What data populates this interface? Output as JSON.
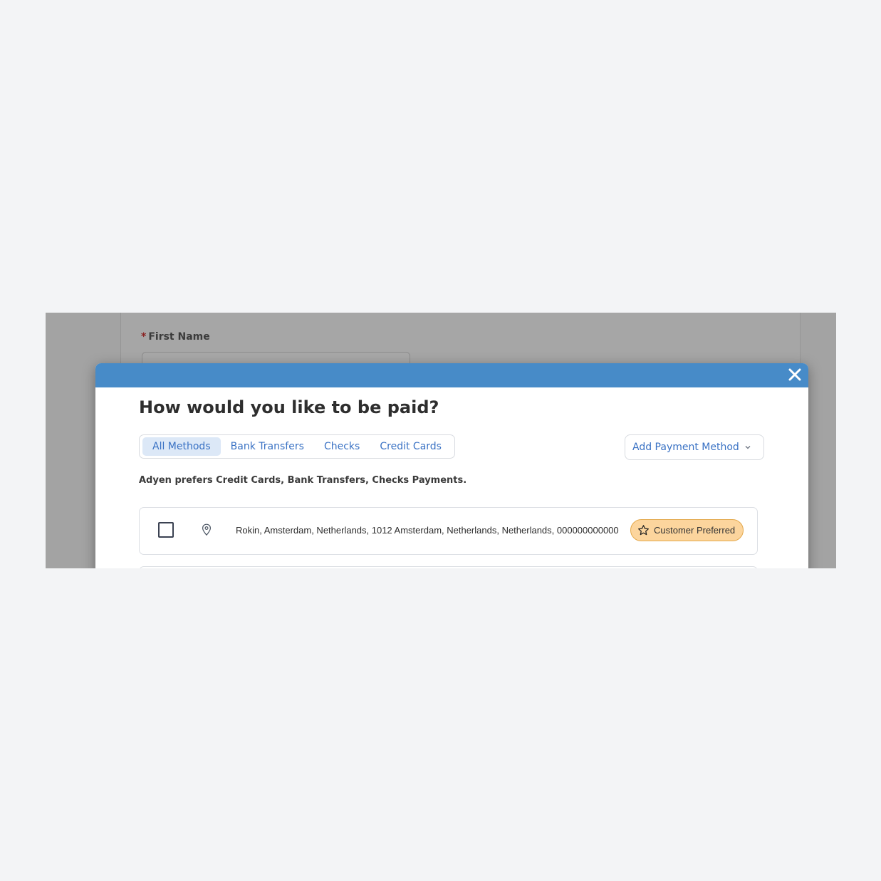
{
  "background_form": {
    "first_name_label": "First Name",
    "required_marker": "*"
  },
  "modal": {
    "title": "How would you like to be paid?",
    "header_color": "#478bc8",
    "close_icon": "close-icon",
    "tabs": [
      {
        "label": "All Methods",
        "active": true
      },
      {
        "label": "Bank Transfers",
        "active": false
      },
      {
        "label": "Checks",
        "active": false
      },
      {
        "label": "Credit Cards",
        "active": false
      }
    ],
    "add_button_label": "Add Payment Method",
    "preference_text": "Adyen prefers Credit Cards, Bank Transfers, Checks Payments.",
    "methods": [
      {
        "checked": false,
        "icon": "location-pin-icon",
        "address": "Rokin, Amsterdam, Netherlands, 1012 Amsterdam, Netherlands, Netherlands, 000000000000",
        "badge_label": "Customer Preferred",
        "badge_icon": "star-icon"
      }
    ]
  },
  "colors": {
    "accent": "#3a72c4",
    "badge_bg": "#fcd59d",
    "badge_border": "#e3a84b",
    "page_bg": "#f3f4f6",
    "overlay": "#a3a3a3"
  }
}
